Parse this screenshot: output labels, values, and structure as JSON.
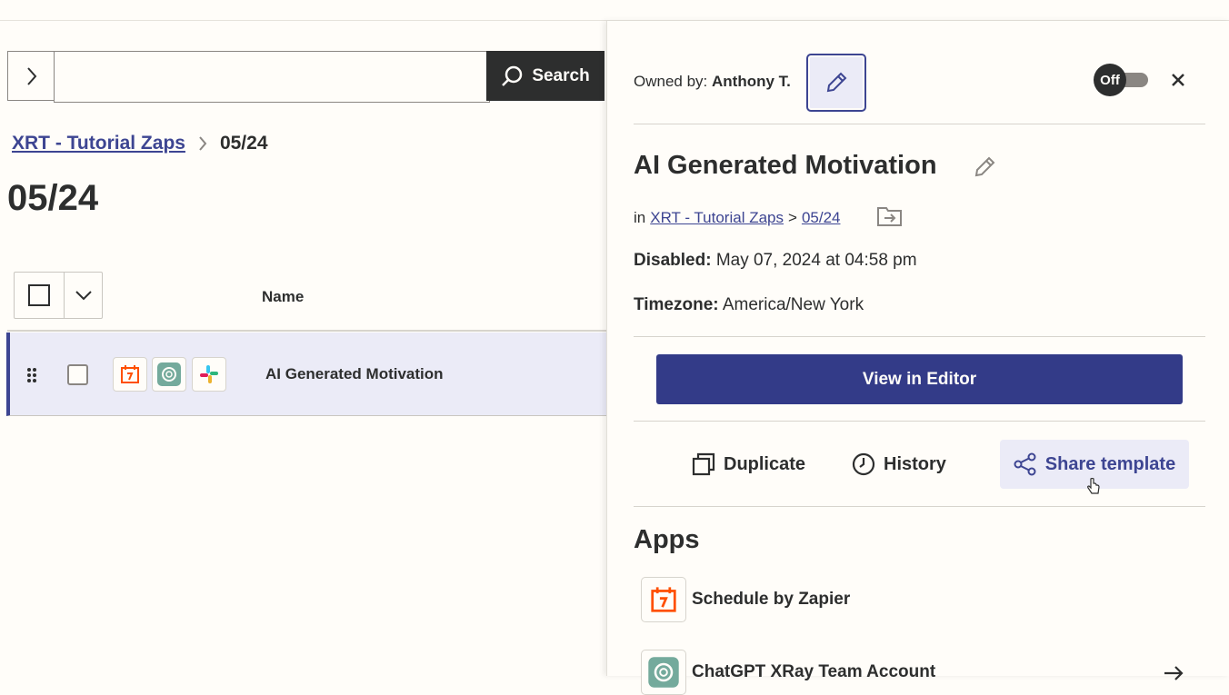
{
  "search": {
    "button_label": "Search",
    "placeholder": ""
  },
  "breadcrumb": {
    "folder": "XRT - Tutorial Zaps",
    "current": "05/24"
  },
  "page": {
    "title": "05/24"
  },
  "table": {
    "column_name": "Name",
    "rows": [
      {
        "name": "AI Generated Motivation",
        "apps": [
          "schedule-icon",
          "chatgpt-icon",
          "slack-icon"
        ]
      }
    ]
  },
  "panel": {
    "owner_label": "Owned by:",
    "owner_name": "Anthony T.",
    "toggle_label": "Off",
    "zap_title": "AI Generated Motivation",
    "location_prefix": "in",
    "location_folder": "XRT - Tutorial Zaps",
    "location_sep": ">",
    "location_sub": "05/24",
    "disabled_label": "Disabled:",
    "disabled_value": "May 07, 2024 at 04:58 pm",
    "timezone_label": "Timezone:",
    "timezone_value": "America/New York",
    "view_editor": "View in Editor",
    "actions": {
      "duplicate": "Duplicate",
      "history": "History",
      "share": "Share template"
    },
    "apps_heading": "Apps",
    "apps": [
      {
        "name": "Schedule by Zapier"
      },
      {
        "name": "ChatGPT XRay Team Account"
      }
    ]
  },
  "colors": {
    "accent": "#333b88",
    "selected_row": "#ebebf7",
    "background": "#fffdf9",
    "dark": "#2d2e2e",
    "schedule_orange": "#ff4f00",
    "chatgpt_teal": "#74aa9c"
  }
}
